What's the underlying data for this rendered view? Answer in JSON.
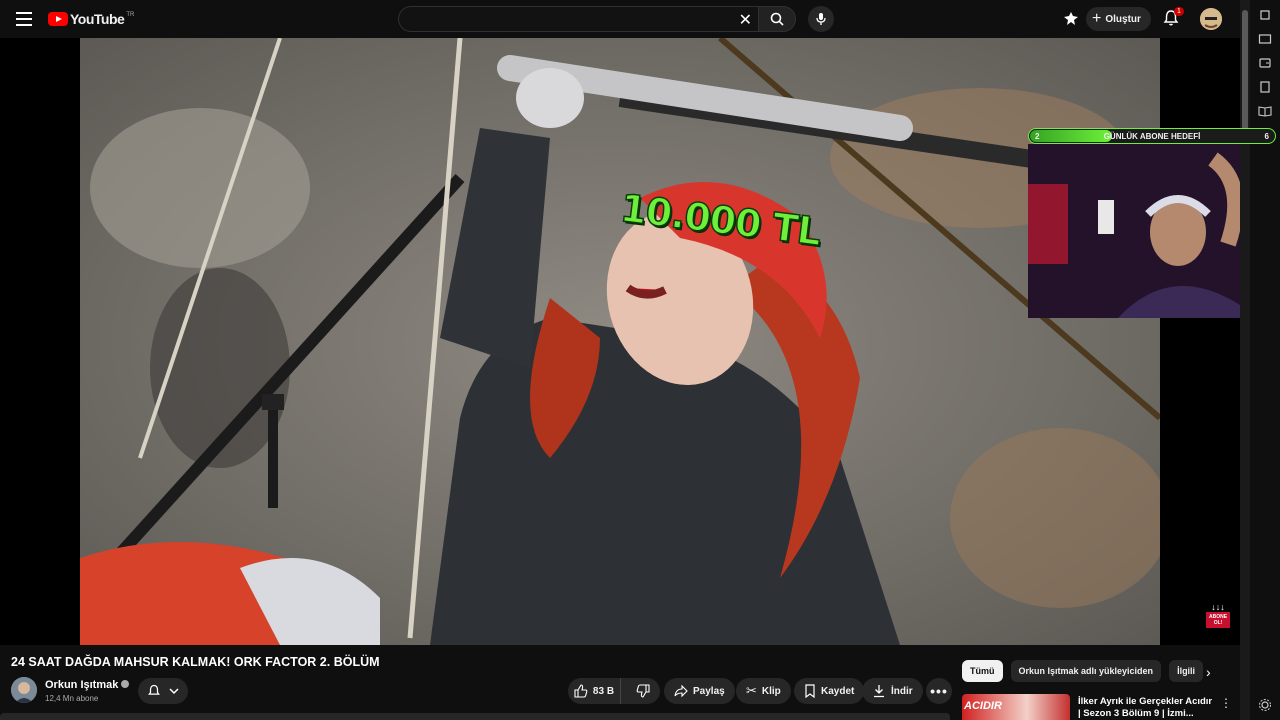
{
  "header": {
    "logo_text": "YouTube",
    "logo_sup": "TR",
    "search_value": "",
    "search_placeholder": "",
    "create_label": "Oluştur",
    "notification_count": "1",
    "icons": [
      "menu-icon",
      "search-icon",
      "mic-icon",
      "create-studio-icon",
      "plus-icon",
      "bell-icon",
      "close-icon"
    ]
  },
  "video": {
    "overlay_text": "10.000 TL",
    "goal_label": "GÜNLÜK ABONE HEDEFİ",
    "goal_current": "2",
    "goal_target": "6",
    "goal_fraction": 0.333,
    "corner_logo_text": "ABONE OL!"
  },
  "info": {
    "title": "24 SAAT DAĞDA MAHSUR KALMAK! ORK FACTOR 2. BÖLÜM",
    "channel_name": "Orkun Işıtmak",
    "subscriber_count": "12,4 Mn abone",
    "actions": {
      "like_count": "83 B",
      "share": "Paylaş",
      "clip": "Klip",
      "save": "Kaydet",
      "download": "İndir"
    }
  },
  "sidebar": {
    "chips": [
      "Tümü",
      "Orkun Işıtmak adlı yükleyiciden",
      "İlgili"
    ],
    "recommendation": {
      "thumb_text": "ACIDIR",
      "title": "İlker Ayrık ile Gerçekler Acıdır | Sezon 3 Bölüm 9 | İzmi..."
    }
  },
  "accent_colors": {
    "youtube_red": "#ff0000",
    "overlay_green": "#6ef03b",
    "badge_red": "#cc0000"
  }
}
